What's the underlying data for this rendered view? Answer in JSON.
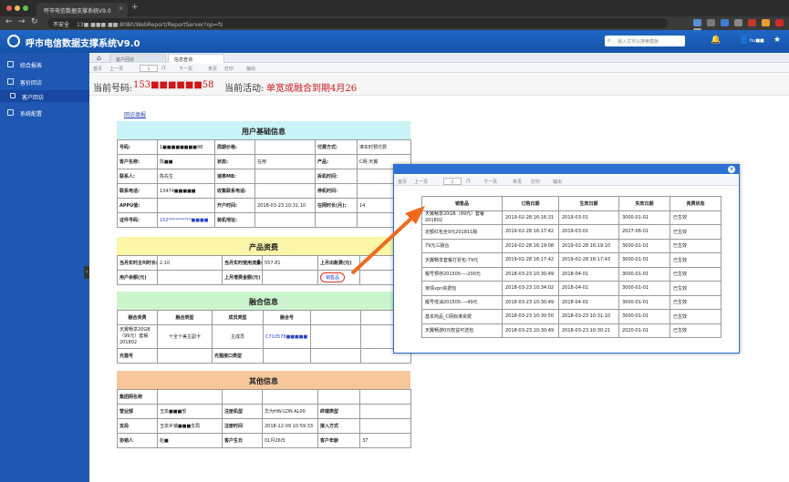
{
  "browser": {
    "tab_title": "呼市电信数据支撑系统V9.0",
    "new_tab": "+",
    "security": "不安全",
    "url": "13■.■■■.■■:8080/WebReport/ReportServer?op=fs",
    "nav_back": "←",
    "nav_forward": "→",
    "nav_reload": "↻"
  },
  "app": {
    "title": "呼市电信数据支撑系统V9.0",
    "search_placeholder": "输入文字以搜索模板",
    "user_name": "hu■■"
  },
  "sidebar": {
    "items": [
      {
        "label": "综合报表"
      },
      {
        "label": "客价回访"
      },
      {
        "label": "客户回访"
      },
      {
        "label": "系统配置"
      }
    ],
    "toggle": "‹"
  },
  "content_tabs": [
    "客户回访",
    "信息查询"
  ],
  "toolbar": {
    "first": "首页",
    "prev": "上一页",
    "page": "1",
    "of": "/1",
    "next": "下一页",
    "last": "末页",
    "print": "打印",
    "export": "输出"
  },
  "infobar": {
    "number_label": "当前号码:",
    "number_value": "153■■■■■■58",
    "activity_label": "当前活动:",
    "activity_value": "单宽或融合到期4月26"
  },
  "report_link": "回访填报",
  "basic": {
    "title": "用户基础信息",
    "rows": [
      [
        "号码:",
        "1■■■■■■■■98",
        "周期价格:",
        "",
        "付费方式:",
        "准实时预付费"
      ],
      [
        "客户名称:",
        "陈■■",
        "状态:",
        "在用",
        "产品:",
        "C网-天翼"
      ],
      [
        "联系人:",
        "陈先生",
        "速率MB:",
        "",
        "拆机时间:",
        ""
      ],
      [
        "联系电话:",
        "13474■■■■■",
        "收集联系电话:",
        "",
        "停机时间:",
        ""
      ],
      [
        "APPU值:",
        "",
        "开户时间:",
        "2018-03-23 10:31:10",
        "在网时长(月):",
        "14"
      ],
      [
        "证件号码:",
        "152**********■■■■",
        "装机地址:",
        "",
        "",
        ""
      ]
    ]
  },
  "product": {
    "title": "产品资费",
    "rows": [
      [
        "当月实时主叫时长(分钟)",
        "2.10",
        "当月实时使用流量(MB)",
        "557.81",
        "上月出账费(元)",
        ""
      ],
      [
        "用户余额(元)",
        "",
        "上月增费金额(元)",
        "",
        "销售品",
        ""
      ]
    ]
  },
  "fusion": {
    "title": "融合信息",
    "header": [
      "融合资费",
      "融合类型",
      "成员类型",
      "融合号"
    ],
    "row": [
      "天翼畅享20GB（99元）套餐201802",
      "十全十美主副卡",
      "主成员",
      "C710578■■■■■"
    ],
    "broadband_label": "光猫号",
    "broadband_port_label": "光猫接口类型"
  },
  "other": {
    "title": "其他信息",
    "rows": [
      [
        "集团网名称",
        "",
        "",
        "",
        "",
        ""
      ],
      [
        "营业部",
        "玉泉■■■部",
        "注册机型",
        "华为HW-LDN AL00",
        "终端类型",
        ""
      ],
      [
        "支局",
        "玉泉乡镇■■■支局",
        "注册时间",
        "2018-12-09 10:59:33",
        "接入方式",
        ""
      ],
      [
        "协销人",
        "赵■",
        "客户生日",
        "01月26日",
        "客户年龄",
        "37"
      ]
    ]
  },
  "popup": {
    "close": "×",
    "toolbar": {
      "first": "首页",
      "prev": "上一页",
      "page": "1",
      "of": "/1",
      "next": "下一页",
      "last": "末页",
      "print": "打印",
      "export": "输出"
    },
    "header": [
      "销售品",
      "订购日期",
      "生效日期",
      "失效日期",
      "资费状态"
    ],
    "rows": [
      [
        "天翼畅享20GB（99元）套餐201802",
        "2019-02-28 16:16:31",
        "2019-03-01",
        "3000-01-01",
        "已生效"
      ],
      [
        "定额红包全9元201811版",
        "2019-02-28 16:17:42",
        "2019-03-01",
        "2027-06-01",
        "已生效"
      ],
      [
        "79元三融合",
        "2019-02-28 16:19:08",
        "2019-02-28 16:19:10",
        "3000-01-01",
        "已生效"
      ],
      [
        "天翼畅享套餐打折包-79元",
        "2019-02-28 16:17:42",
        "2019-02-28 16:17:43",
        "3000-01-01",
        "已生效"
      ],
      [
        "靓号预存201505----200元",
        "2018-03-23 10:30:49",
        "2018-04-01",
        "3000-01-01",
        "已生效"
      ],
      [
        "亲情vpn资费包",
        "2018-03-23 10:34:02",
        "2018-04-01",
        "3000-01-01",
        "已生效"
      ],
      [
        "靓号低消201505----49元",
        "2018-03-23 10:30:49",
        "2018-04-01",
        "3000-01-01",
        "已生效"
      ],
      [
        "基本商品_C网标准资费",
        "2018-03-23 10:30:50",
        "2018-03-23 10:31:10",
        "3000-01-01",
        "已生效"
      ],
      [
        "天翼畅游0元权益可选包",
        "2018-03-23 10:30:49",
        "2018-03-23 10:30:21",
        "2020-01-01",
        "已生效"
      ]
    ]
  },
  "colors": {
    "app_blue": "#1f67c6",
    "basic_head": "#c9f3f6",
    "product_head": "#fbf6a8",
    "fusion_head": "#ccf4cd",
    "other_head": "#f6c79a",
    "highlight_red": "#d0161b",
    "arrow": "#f06a1c"
  },
  "icons": [
    "back-icon",
    "forward-icon",
    "reload-icon",
    "logo-icon",
    "search-icon",
    "bell-icon",
    "user-icon",
    "star-icon",
    "home-icon",
    "print-icon",
    "export-icon",
    "close-icon"
  ]
}
